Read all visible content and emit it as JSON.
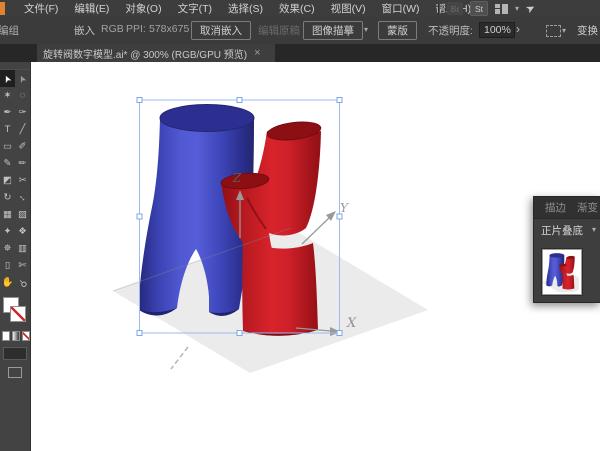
{
  "menu_bar": {
    "items": [
      {
        "name": "menu-file",
        "label": "文件(F)"
      },
      {
        "name": "menu-edit",
        "label": "编辑(E)"
      },
      {
        "name": "menu-object",
        "label": "对象(O)"
      },
      {
        "name": "menu-type",
        "label": "文字(T)"
      },
      {
        "name": "menu-select",
        "label": "选择(S)"
      },
      {
        "name": "menu-effect",
        "label": "效果(C)"
      },
      {
        "name": "menu-view",
        "label": "视图(V)"
      },
      {
        "name": "menu-window",
        "label": "窗口(W)"
      },
      {
        "name": "menu-help",
        "label": "帮助(H)"
      }
    ],
    "bridge_badge": "Br",
    "stock_badge": "St"
  },
  "control_bar": {
    "selection_type": "编组",
    "embed_status": "嵌入",
    "color_mode": "RGB",
    "ppi_label": "PPI:",
    "ppi_value": "578x675",
    "unembed_button": "取消嵌入",
    "edit_original_button": "编辑原稿",
    "image_trace_button": "图像描摹",
    "mask_button": "蒙版",
    "opacity_label": "不透明度:",
    "opacity_value": "100%",
    "transform_label": "变换"
  },
  "document_tab": {
    "title": "旋转阀数字模型.ai* @ 300% (RGB/GPU 预览)",
    "close_glyph": "×"
  },
  "toolbar": {
    "tools": [
      {
        "name": "selection-tool",
        "glyph": "➤",
        "cls": "rotNW",
        "selected": true
      },
      {
        "name": "direct-selection-tool",
        "glyph": "➤",
        "cls": "rotNW dim"
      },
      {
        "name": "magic-wand-tool",
        "glyph": "✶"
      },
      {
        "name": "lasso-tool",
        "glyph": "◌"
      },
      {
        "name": "pen-tool",
        "glyph": "✒"
      },
      {
        "name": "curvature-tool",
        "glyph": "✑"
      },
      {
        "name": "type-tool",
        "glyph": "T"
      },
      {
        "name": "line-segment-tool",
        "glyph": "╱"
      },
      {
        "name": "rectangle-tool",
        "glyph": "▭"
      },
      {
        "name": "paintbrush-tool",
        "glyph": "✐"
      },
      {
        "name": "pencil-tool",
        "glyph": "✎"
      },
      {
        "name": "shaper-tool",
        "glyph": "✏"
      },
      {
        "name": "eraser-tool",
        "glyph": "◩"
      },
      {
        "name": "scissors-tool",
        "glyph": "✂"
      },
      {
        "name": "rotate-tool",
        "glyph": "↻"
      },
      {
        "name": "scale-tool",
        "glyph": "↔",
        "cls": "rot45"
      },
      {
        "name": "mesh-tool",
        "glyph": "▦"
      },
      {
        "name": "gradient-tool",
        "glyph": "▧"
      },
      {
        "name": "blend-tool",
        "glyph": "✦"
      },
      {
        "name": "shape-builder-tool",
        "glyph": "❖"
      },
      {
        "name": "symbol-sprayer-tool",
        "glyph": "✵"
      },
      {
        "name": "graph-tool",
        "glyph": "▥"
      },
      {
        "name": "artboard-tool",
        "glyph": "▯"
      },
      {
        "name": "slice-tool",
        "glyph": "✄"
      },
      {
        "name": "hand-tool",
        "glyph": "✋"
      },
      {
        "name": "zoom-tool",
        "glyph": "⚲",
        "cls": "rot135"
      }
    ]
  },
  "canvas": {
    "axis_labels": {
      "x": "X",
      "y": "Y",
      "z": "Z"
    },
    "zoom_level": "300%",
    "colors": {
      "selection": "#9db9f0",
      "model_blue": "#4a52cf",
      "model_red": "#d8232b",
      "ground_plane": "#ebebeb"
    }
  },
  "transparency_panel": {
    "tabs": [
      {
        "name": "tab-stroke",
        "label": "描边"
      },
      {
        "name": "tab-gradient",
        "label": "渐变"
      }
    ],
    "blend_mode": "正片叠底"
  },
  "icons": {
    "chevron_down": "▾",
    "chevron_right": "›",
    "share": "➤"
  }
}
